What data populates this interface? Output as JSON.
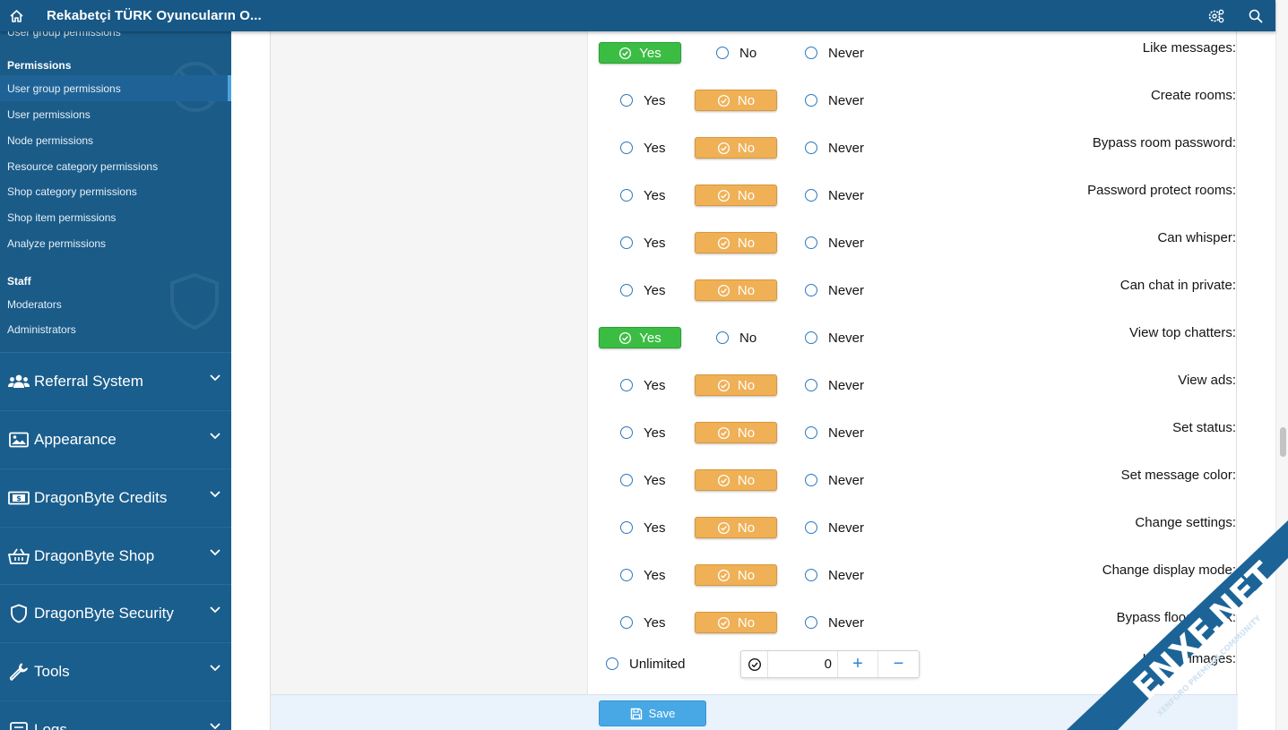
{
  "header": {
    "title": "Rekabetçi TÜRK Oyuncuların O...",
    "icons": [
      "home-icon",
      "settings-cog-icon",
      "search-icon"
    ]
  },
  "sidebar": {
    "cut_item": "User group permissions",
    "sections": [
      {
        "heading": "Permissions",
        "links": [
          {
            "label": "User group permissions",
            "active": true
          },
          {
            "label": "User permissions"
          },
          {
            "label": "Node permissions"
          },
          {
            "label": "Resource category permissions"
          },
          {
            "label": "Shop category permissions"
          },
          {
            "label": "Shop item permissions"
          },
          {
            "label": "Analyze permissions"
          }
        ]
      },
      {
        "heading": "Staff",
        "links": [
          {
            "label": "Moderators"
          },
          {
            "label": "Administrators"
          }
        ]
      }
    ],
    "nav": [
      {
        "label": "Referral System",
        "icon": "users-icon"
      },
      {
        "label": "Appearance",
        "icon": "image-icon"
      },
      {
        "label": "DragonByte Credits",
        "icon": "money-icon"
      },
      {
        "label": "DragonByte Shop",
        "icon": "basket-icon"
      },
      {
        "label": "DragonByte Security",
        "icon": "shield-icon"
      },
      {
        "label": "Tools",
        "icon": "wrench-icon"
      },
      {
        "label": "Logs",
        "icon": "logs-icon"
      }
    ]
  },
  "options": {
    "yes": "Yes",
    "no": "No",
    "never": "Never",
    "unlimited": "Unlimited"
  },
  "permissions": [
    {
      "label": "Like messages:",
      "selected": "yes"
    },
    {
      "label": "Create rooms:",
      "selected": "no"
    },
    {
      "label": "Bypass room password:",
      "selected": "no"
    },
    {
      "label": "Password protect rooms:",
      "selected": "no"
    },
    {
      "label": "Can whisper:",
      "selected": "no"
    },
    {
      "label": "Can chat in private:",
      "selected": "no"
    },
    {
      "label": "View top chatters:",
      "selected": "yes"
    },
    {
      "label": "View ads:",
      "selected": "no"
    },
    {
      "label": "Set status:",
      "selected": "no"
    },
    {
      "label": "Set message color:",
      "selected": "no"
    },
    {
      "label": "Change settings:",
      "selected": "no"
    },
    {
      "label": "Change display mode:",
      "selected": "no"
    },
    {
      "label": "Bypass flood check:",
      "selected": "no"
    }
  ],
  "upload_images": {
    "label": "Upload images:",
    "value": "0",
    "plus": "+",
    "minus": "−"
  },
  "save": {
    "label": "Save"
  },
  "colors": {
    "yes_selected": "#3bbd44",
    "no_selected": "#efb056",
    "header": "#185886",
    "sidebar": "#175a88",
    "save": "#47a8e5"
  },
  "watermark": {
    "brand": "ENXF.NET",
    "tagline": "XENFORO PREMIUM COMMUNITY"
  }
}
